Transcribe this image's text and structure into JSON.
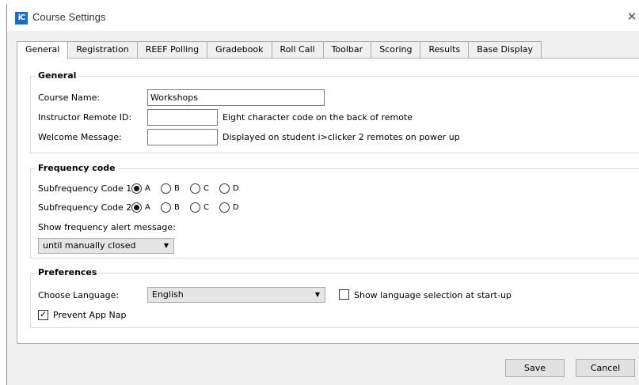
{
  "window": {
    "title": "Course Settings",
    "close_symbol": "✕"
  },
  "tabs": [
    {
      "label": "General",
      "active": true
    },
    {
      "label": "Registration"
    },
    {
      "label": "REEF Polling"
    },
    {
      "label": "Gradebook"
    },
    {
      "label": "Roll Call"
    },
    {
      "label": "Toolbar"
    },
    {
      "label": "Scoring"
    },
    {
      "label": "Results"
    },
    {
      "label": "Base Display"
    }
  ],
  "general": {
    "legend": "General",
    "course_name_label": "Course Name:",
    "course_name_value": "Workshops",
    "instructor_remote_label": "Instructor Remote ID:",
    "instructor_remote_value": "",
    "instructor_remote_hint": "Eight character code on the back of remote",
    "welcome_label": "Welcome Message:",
    "welcome_value": "",
    "welcome_hint": "Displayed on student i>clicker 2 remotes on power up"
  },
  "frequency": {
    "legend": "Frequency code",
    "sub1_label": "Subfrequency Code 1:",
    "sub2_label": "Subfrequency Code 2:",
    "options": [
      "A",
      "B",
      "C",
      "D"
    ],
    "sub1_selected": "A",
    "sub2_selected": "A",
    "alert_label": "Show frequency alert message:",
    "alert_value": "until manually closed"
  },
  "preferences": {
    "legend": "Preferences",
    "language_label": "Choose Language:",
    "language_value": "English",
    "show_language_label": "Show language selection at start-up",
    "show_language_checked": false,
    "prevent_app_nap_label": "Prevent App Nap",
    "prevent_app_nap_checked": true
  },
  "buttons": {
    "save": "Save",
    "cancel": "Cancel"
  },
  "icons": {
    "app": "iclicker-app-icon",
    "close": "close-icon",
    "dropdown": "chevron-down-icon"
  }
}
